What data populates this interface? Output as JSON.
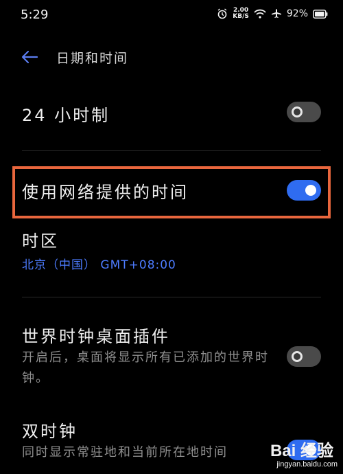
{
  "status_bar": {
    "time": "5:29",
    "net_speed_value": "2.00",
    "net_speed_unit": "KB/S",
    "battery": "92%",
    "icons": [
      "alarm-icon",
      "wifi-icon",
      "airplane-icon",
      "battery-icon"
    ]
  },
  "header": {
    "title": "日期和时间",
    "back_icon": "back-arrow-icon"
  },
  "settings": {
    "format_24h": {
      "label": "24 小时制",
      "enabled": false
    },
    "network_time": {
      "label": "使用网络提供的时间",
      "enabled": true
    },
    "timezone": {
      "label": "时区",
      "value": "北京（中国） GMT+08:00"
    },
    "world_clock_widget": {
      "label": "世界时钟桌面插件",
      "description": "开启后，桌面将显示所有已添加的世界时钟。",
      "enabled": false
    },
    "dual_clock": {
      "label": "双时钟",
      "description": "同时显示常驻地和当前所在地时间",
      "enabled": true
    }
  },
  "watermark": {
    "logo": "Bai 经验",
    "url": "jingyan.baidu.com"
  },
  "colors": {
    "accent": "#2f6cf0",
    "highlight_border": "#e8663d",
    "timezone_text": "#4d7cff",
    "background": "#000000"
  }
}
